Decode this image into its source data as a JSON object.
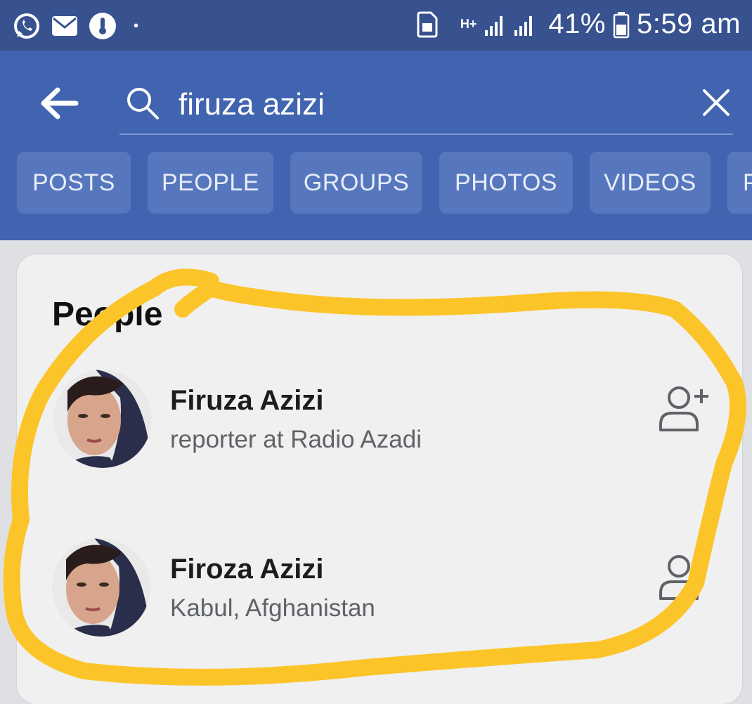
{
  "status_bar": {
    "network": "H+",
    "battery": "41%",
    "time": "5:59 am",
    "icons": [
      "whatsapp-icon",
      "mail-icon",
      "thermometer-icon",
      "sim-icon",
      "signal-icon",
      "battery-icon"
    ]
  },
  "search": {
    "query": "firuza azizi",
    "placeholder": "Search"
  },
  "filters": [
    {
      "label": "POSTS"
    },
    {
      "label": "PEOPLE"
    },
    {
      "label": "GROUPS"
    },
    {
      "label": "PHOTOS"
    },
    {
      "label": "VIDEOS"
    },
    {
      "label": "P"
    }
  ],
  "people": {
    "title": "People",
    "results": [
      {
        "name": "Firuza Azizi",
        "subtitle": "reporter at Radio Azadi"
      },
      {
        "name": "Firoza Azizi",
        "subtitle": "Kabul, Afghanistan"
      }
    ]
  },
  "colors": {
    "status_bar": "#37528f",
    "app_bar": "#4064b0",
    "chip": "#5677bd",
    "highlight": "#fbc52a"
  }
}
